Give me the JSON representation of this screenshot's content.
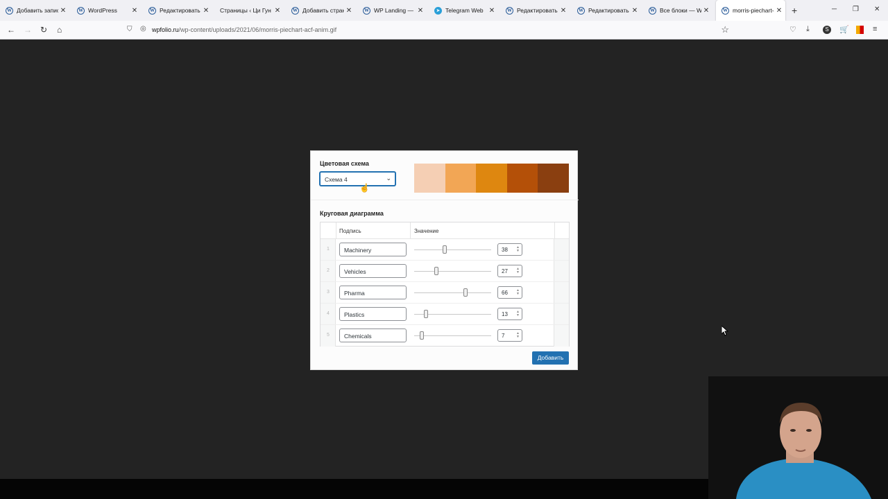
{
  "browser": {
    "tabs": [
      {
        "title": "Добавить запись",
        "icon": "wordpress-icon",
        "active": false
      },
      {
        "title": "WordPress",
        "icon": "wordpress-icon",
        "active": false
      },
      {
        "title": "Редактировать за",
        "icon": "wordpress-icon",
        "active": false
      },
      {
        "title": "Страницы ‹ Ци Гун Д",
        "icon": "none",
        "active": false
      },
      {
        "title": "Добавить страниц",
        "icon": "wordpress-icon",
        "active": false
      },
      {
        "title": "WP Landing — Bu",
        "icon": "wordpress-icon",
        "active": false
      },
      {
        "title": "Telegram Web",
        "icon": "telegram-icon",
        "active": false
      },
      {
        "title": "Редактировать те",
        "icon": "wordpress-icon",
        "active": false
      },
      {
        "title": "Редактировать те",
        "icon": "wordpress-icon",
        "active": false
      },
      {
        "title": "Все блоки — Wor",
        "icon": "wordpress-icon",
        "active": false
      },
      {
        "title": "morris-piechart-a",
        "icon": "wordpress-icon",
        "active": true
      }
    ],
    "url_domain": "wpfolio.ru",
    "url_path": "/wp-content/uploads/2021/06/morris-piechart-acf-anim.gif"
  },
  "form": {
    "color_scheme_title": "Цветовая схема",
    "scheme_value": "Схема 4",
    "palette": [
      "#f5cfb4",
      "#f2a655",
      "#de8710",
      "#b45008",
      "#8a3f10"
    ],
    "pie_title": "Круговая диаграмма",
    "col_label": "Подпись",
    "col_value": "Значение",
    "rows": [
      {
        "n": "1",
        "label": "Machinery",
        "value": "38"
      },
      {
        "n": "2",
        "label": "Vehicles",
        "value": "27"
      },
      {
        "n": "3",
        "label": "Pharma",
        "value": "66"
      },
      {
        "n": "4",
        "label": "Plastics",
        "value": "13"
      },
      {
        "n": "5",
        "label": "Chemicals",
        "value": "7"
      }
    ],
    "add_label": "Добавить",
    "accent": "#2271b1"
  }
}
